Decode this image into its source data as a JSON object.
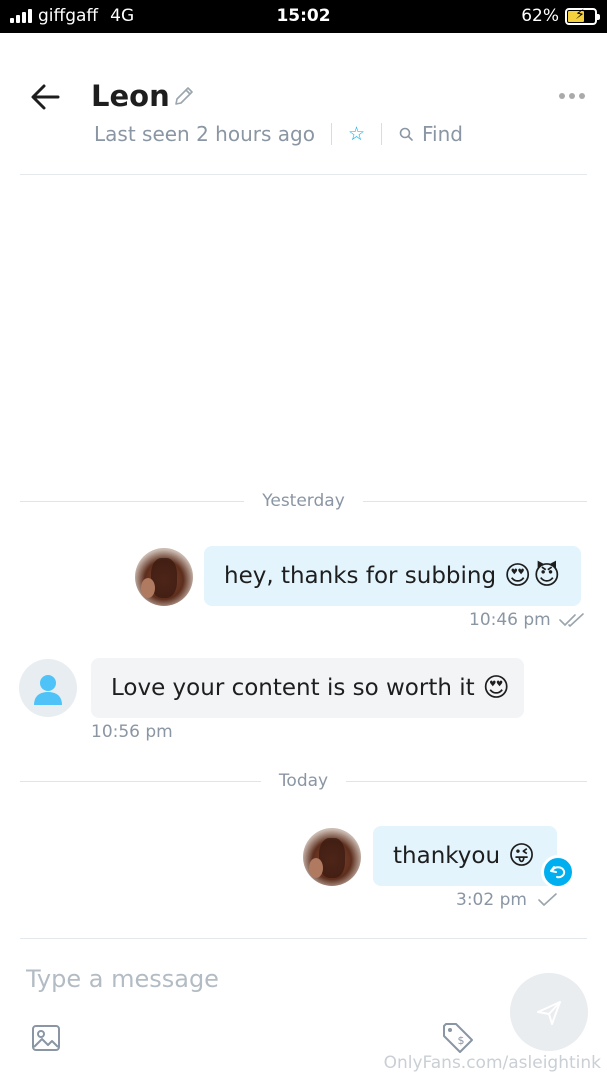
{
  "status_bar": {
    "carrier": "giffgaff",
    "network": "4G",
    "time": "15:02",
    "battery": "62%",
    "battery_level": 0.62
  },
  "header": {
    "contact_name": "Leon",
    "last_seen": "Last seen 2 hours ago",
    "find_label": "Find",
    "accent_color": "#00aff0"
  },
  "messages": {
    "yesterday_label": "Yesterday",
    "today_label": "Today",
    "items": [
      {
        "direction": "out",
        "text": "hey, thanks for subbing",
        "emoji": [
          "😍",
          "😈"
        ],
        "time": "10:46 pm",
        "status": "read"
      },
      {
        "direction": "in",
        "text": "Love your content is so worth it",
        "emoji": [
          "😍"
        ],
        "time": "10:56 pm"
      },
      {
        "direction": "out",
        "text": "thankyou",
        "emoji": [
          "😜"
        ],
        "time": "3:02 pm",
        "status": "sent"
      }
    ]
  },
  "composer": {
    "placeholder": "Type a message"
  },
  "icons": {
    "back": "arrow-left-icon",
    "edit": "pencil-icon",
    "more": "more-dots-icon",
    "favorite": "star-icon",
    "find": "search-icon",
    "image": "image-icon",
    "price_tag": "dollar-tag-icon",
    "send": "send-icon",
    "undo": "undo-icon"
  },
  "watermark": "OnlyFans.com/asleightink"
}
